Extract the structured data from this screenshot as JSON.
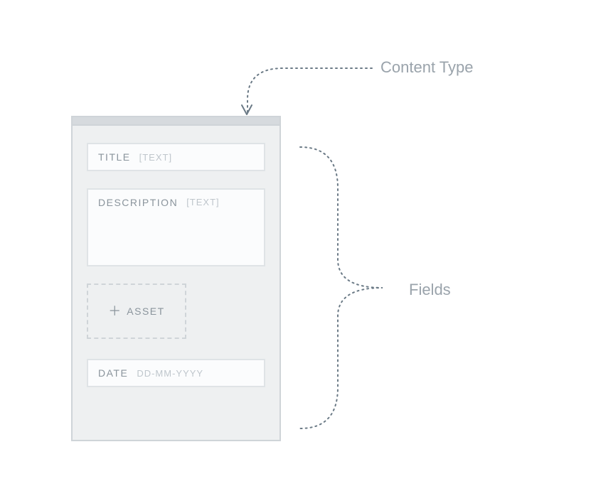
{
  "annotations": {
    "content_type": "Content Type",
    "fields": "Fields"
  },
  "panel": {
    "fields": [
      {
        "label": "TITLE",
        "hint": "[TEXT]"
      },
      {
        "label": "DESCRIPTION",
        "hint": "[TEXT]"
      },
      {
        "label": "ASSET",
        "hint": ""
      },
      {
        "label": "DATE",
        "hint": "DD-MM-YYYY"
      }
    ]
  },
  "icons": {
    "plus": "＋"
  },
  "colors": {
    "line": "#6b7a86",
    "text": "#9aa3ab",
    "panel_border": "#cfd4d8",
    "panel_bg": "#eef0f1"
  }
}
